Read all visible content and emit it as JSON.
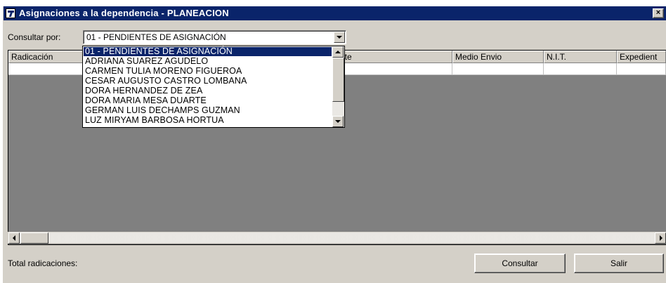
{
  "window": {
    "title": "Asignaciones a la dependencia  -  PLANEACION",
    "close_glyph": "×"
  },
  "filter": {
    "label": "Consultar por:",
    "selected_value": "01 - PENDIENTES DE ASIGNACIÓN",
    "options": [
      "01 - PENDIENTES DE ASIGNACIÓN",
      "ADRIANA SUAREZ AGUDELO",
      "CARMEN TULIA MORENO FIGUEROA",
      "CESAR AUGUSTO CASTRO LOMBANA",
      "DORA HERNANDEZ DE ZEA",
      "DORA MARIA MESA DUARTE",
      "GERMAN LUIS DECHAMPS GUZMAN",
      "LUZ MIRYAM BARBOSA HORTUA"
    ]
  },
  "grid": {
    "columns": [
      "Radicación",
      "",
      "ite",
      "Medio Envio",
      "N.I.T.",
      "Expedient"
    ]
  },
  "footer": {
    "total_label": "Total radicaciones:",
    "consultar_label": "Consultar",
    "salir_label": "Salir"
  },
  "colors": {
    "titlebar": "#0a246a",
    "face": "#d4d0c8",
    "grid_bg": "#808080",
    "selection": "#0a246a"
  },
  "icons": [
    "app-icon",
    "close-icon",
    "chevron-down-icon",
    "scroll-left-icon",
    "scroll-right-icon",
    "scroll-up-icon",
    "scroll-down-icon"
  ]
}
